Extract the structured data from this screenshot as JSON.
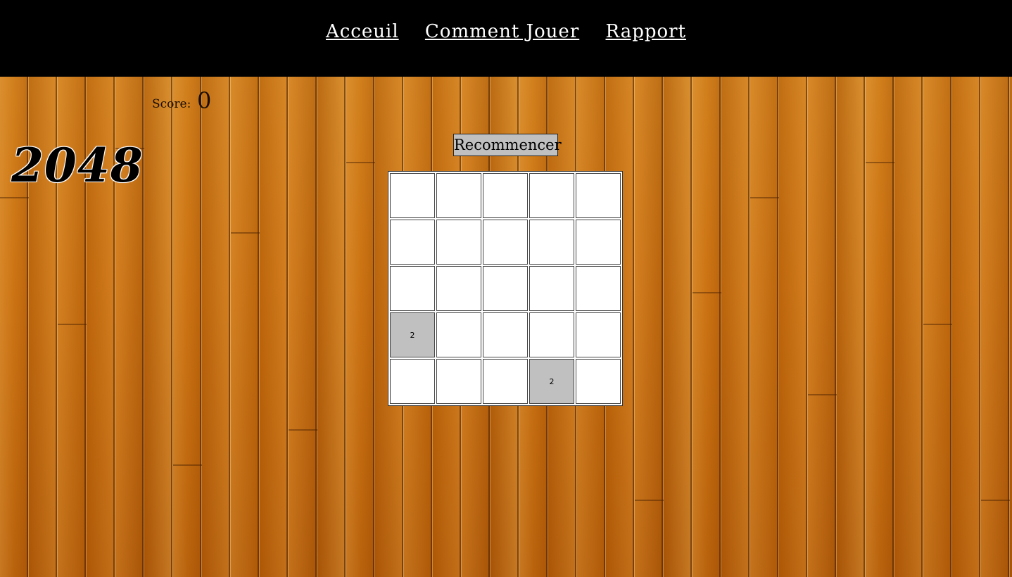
{
  "nav": {
    "items": [
      {
        "label": "Acceuil"
      },
      {
        "label": "Comment Jouer"
      },
      {
        "label": "Rapport"
      }
    ]
  },
  "score": {
    "label": "Score:",
    "value": "0"
  },
  "logo": {
    "text": "2048"
  },
  "controls": {
    "restart_label": "Recommencer"
  },
  "board": {
    "size": 5,
    "tile_color": "#c0c0c0",
    "empty_color": "#ffffff",
    "rows": [
      [
        "",
        "",
        "",
        "",
        ""
      ],
      [
        "",
        "",
        "",
        "",
        ""
      ],
      [
        "",
        "",
        "",
        "",
        ""
      ],
      [
        "2",
        "",
        "",
        "",
        ""
      ],
      [
        "",
        "",
        "",
        "2",
        ""
      ]
    ]
  },
  "colors": {
    "topbar": "#000000",
    "wood": "#c46d12"
  }
}
